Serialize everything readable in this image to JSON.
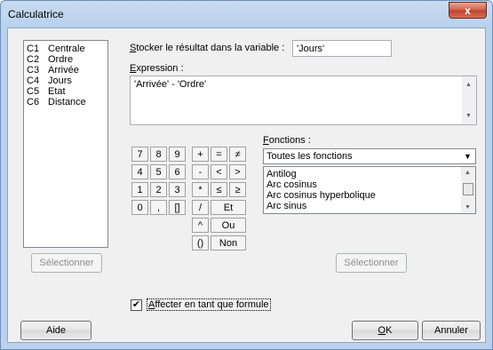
{
  "window": {
    "title": "Calculatrice",
    "close_label": "x"
  },
  "variables": [
    {
      "col": "C1",
      "name": "Centrale"
    },
    {
      "col": "C2",
      "name": "Ordre"
    },
    {
      "col": "C3",
      "name": "Arrivée"
    },
    {
      "col": "C4",
      "name": "Jours"
    },
    {
      "col": "C5",
      "name": "Etat"
    },
    {
      "col": "C6",
      "name": "Distance"
    }
  ],
  "store": {
    "label_prefix": "S",
    "label_rest": "tocker le résultat dans la variable :",
    "value": "'Jours'"
  },
  "expression": {
    "label_prefix": "E",
    "label_rest": "xpression :",
    "value": "'Arrivée' - 'Ordre'"
  },
  "keypad": {
    "r1": [
      "7",
      "8",
      "9",
      "+",
      "=",
      "≠"
    ],
    "r2": [
      "4",
      "5",
      "6",
      "-",
      "<",
      ">"
    ],
    "r3": [
      "1",
      "2",
      "3",
      "*",
      "≤",
      "≥"
    ],
    "r4": [
      "0",
      ",",
      "[]",
      "/",
      "Et"
    ],
    "r5": [
      "^",
      "Ou"
    ],
    "r6": [
      "()",
      "Non"
    ]
  },
  "functions": {
    "label_prefix": "F",
    "label_rest": "onctions :",
    "selected": "Toutes les fonctions",
    "items": [
      "Antilog",
      "Arc cosinus",
      "Arc cosinus hyperbolique",
      "Arc sinus"
    ]
  },
  "buttons": {
    "select_left": "Sélectionner",
    "select_right": "Sélectionner",
    "help": "Aide",
    "ok_prefix": "O",
    "ok_rest": "K",
    "cancel": "Annuler"
  },
  "formula": {
    "checked_mark": "✔",
    "label_prefix": "A",
    "label_rest": "ffecter en tant que formule"
  }
}
